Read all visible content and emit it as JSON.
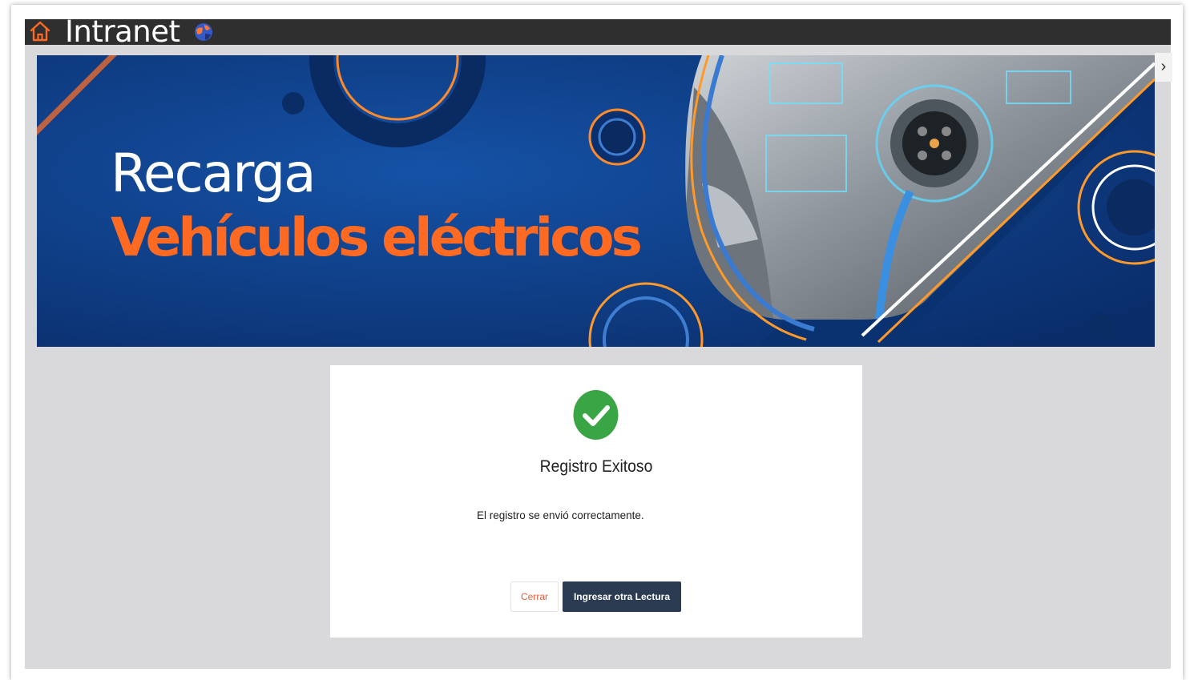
{
  "header": {
    "brand": "Intranet",
    "home_icon": "home-icon",
    "globe_icon": "globe-icon",
    "background": "#2f2f2f"
  },
  "banner": {
    "line1": "Recarga",
    "line2": "Vehículos eléctricos",
    "line1_color": "#ffffff",
    "line2_color": "#ff6a23",
    "background": "#0d3a80"
  },
  "side_nav": {
    "icon": "chevron-right-icon",
    "glyph": "›"
  },
  "modal": {
    "icon": "check-circle-icon",
    "icon_color": "#3aa545",
    "title": "Registro Exitoso",
    "message": "El registro se envió correctamente.",
    "close_label": "Cerrar",
    "primary_label": "Ingresar otra Lectura",
    "primary_color": "#2a3b52"
  }
}
